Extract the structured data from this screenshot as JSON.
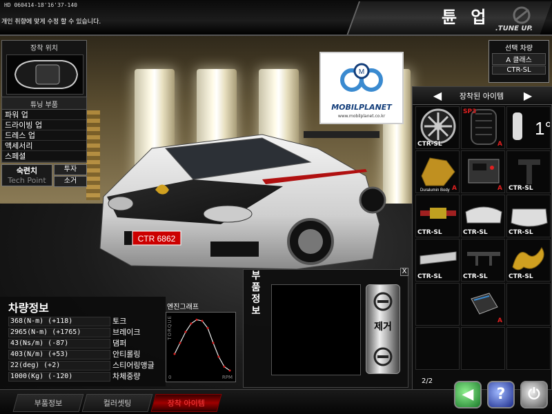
{
  "header": {
    "build": "HD 060414-18'16'37-140",
    "notice": "개인 취향에 맞게 수정 할 수 있습니다.",
    "title_ko": "튠 업",
    "title_en": ".TUNE UP."
  },
  "mount_panel": {
    "title": "장착 위치"
  },
  "tuning_panel": {
    "title": "튜닝 부품",
    "items": [
      "파워 업",
      "드라이빙 업",
      "드레스 업",
      "액세서리",
      "스페셜"
    ]
  },
  "skill": {
    "label": "숙련치",
    "tech_point_label": "Tech Point"
  },
  "buttons": {
    "invest": "투자",
    "consume": "소거"
  },
  "selected_vehicle": {
    "title": "선택 차량",
    "class": "A 클래스",
    "model": "CTR-SL"
  },
  "banner": {
    "brand": "MOBILPLANET",
    "url": "www.mobilplanet.co.kr"
  },
  "license_plate": "CTR 6862",
  "equipped": {
    "title": "장착된 아이템",
    "page": "2/2",
    "items": [
      {
        "tag": "CTR-SL",
        "grade": "",
        "icon": "wheel-icon"
      },
      {
        "tag": "",
        "grade": "A",
        "icon": "tire-icon",
        "extra": "SP3"
      },
      {
        "tag": "",
        "grade": "",
        "icon": "camber-icon",
        "extra": "1°"
      },
      {
        "tag": "",
        "grade": "A",
        "icon": "body-kit-icon",
        "extra": "Duralumin Body"
      },
      {
        "tag": "",
        "grade": "A",
        "icon": "ecu-icon"
      },
      {
        "tag": "CTR-SL",
        "grade": "",
        "icon": "tuning-part-icon"
      },
      {
        "tag": "CTR-SL",
        "grade": "",
        "icon": "shock-absorber-icon"
      },
      {
        "tag": "CTR-SL",
        "grade": "",
        "icon": "front-bumper-icon"
      },
      {
        "tag": "CTR-SL",
        "grade": "",
        "icon": "rear-bumper-icon"
      },
      {
        "tag": "CTR-SL",
        "grade": "",
        "icon": "side-skirt-icon"
      },
      {
        "tag": "CTR-SL",
        "grade": "",
        "icon": "spoiler-icon"
      },
      {
        "tag": "CTR-SL",
        "grade": "",
        "icon": "dragon-decal-icon"
      },
      {
        "tag": "",
        "grade": "",
        "icon": "empty"
      },
      {
        "tag": "",
        "grade": "A",
        "icon": "book-icon"
      },
      {
        "tag": "",
        "grade": "",
        "icon": "empty"
      },
      {
        "tag": "",
        "grade": "",
        "icon": "empty"
      },
      {
        "tag": "",
        "grade": "",
        "icon": "empty"
      },
      {
        "tag": "",
        "grade": "",
        "icon": "empty"
      }
    ]
  },
  "vehicle_info": {
    "title": "차량정보",
    "stats": [
      {
        "value": "368(N-m) (+118)",
        "name": "토크"
      },
      {
        "value": "2965(N-m) (+1765)",
        "name": "브레이크"
      },
      {
        "value": "43(Ns/m) (-87)",
        "name": "댐퍼"
      },
      {
        "value": "403(N/m) (+53)",
        "name": "안티롤링"
      },
      {
        "value": "22(deg) (+2)",
        "name": "스티어링앵글"
      },
      {
        "value": "1000(Kg) (-120)",
        "name": "차체중량"
      }
    ]
  },
  "engine_graph": {
    "title": "엔진그래프",
    "ylabel": "TORQUE",
    "xlabel": "RPM",
    "origin": "0",
    "curve": [
      [
        0.0,
        0.35
      ],
      [
        0.1,
        0.55
      ],
      [
        0.2,
        0.75
      ],
      [
        0.3,
        0.9
      ],
      [
        0.4,
        0.97
      ],
      [
        0.5,
        0.95
      ],
      [
        0.6,
        0.82
      ],
      [
        0.7,
        0.55
      ],
      [
        0.8,
        0.3
      ],
      [
        0.9,
        0.12
      ],
      [
        1.0,
        0.05
      ]
    ]
  },
  "part_info": {
    "label": "부품정보",
    "remove": "제거",
    "close": "X"
  },
  "tabs": [
    "부품정보",
    "컬러셋팅",
    "장착 아이템"
  ],
  "colors": {
    "accent_red": "#e02020",
    "tab_active": "#a00000"
  }
}
